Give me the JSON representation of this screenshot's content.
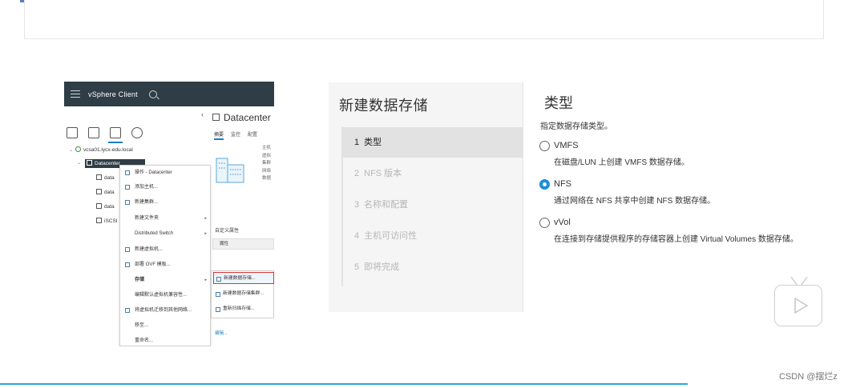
{
  "vsphere": {
    "app_title": "vSphere Client",
    "vcenter_host": "vcsa01.lycx-edu.local",
    "datacenter": "Datacenter",
    "tree_items": [
      "data",
      "data",
      "data",
      "iSCSI"
    ],
    "context_menu": {
      "header": "操作 - Datacenter",
      "items": [
        {
          "label": "添加主机...",
          "icon": "add-host-icon"
        },
        {
          "label": "新建集群...",
          "icon": "cluster-icon"
        },
        {
          "label": "新建文件夹",
          "submenu": true
        },
        {
          "label": "Distributed Switch",
          "submenu": true
        },
        {
          "label": "新建虚拟机...",
          "icon": "vm-icon"
        },
        {
          "label": "部署 OVF 模板...",
          "icon": "ovf-icon"
        },
        {
          "label": "存储",
          "submenu": true
        },
        {
          "label": "编辑默认虚拟机兼容性..."
        },
        {
          "label": "将虚拟机迁移到其他网络...",
          "icon": "migrate-icon"
        },
        {
          "label": "移至..."
        },
        {
          "label": "重命名..."
        }
      ]
    },
    "storage_submenu": [
      "新建数据存储...",
      "新建数据存储集群...",
      "重新扫描存储..."
    ],
    "right_pane": {
      "title": "Datacenter",
      "tabs": [
        "摘要",
        "监控",
        "配置"
      ],
      "info_lines": [
        "主机",
        "虚拟",
        "集群",
        "网络",
        "数据"
      ],
      "custom_attrs_title": "自定义属性",
      "attr_header": "属性",
      "edit_link": "编辑..."
    }
  },
  "wizard": {
    "title": "新建数据存储",
    "steps": [
      {
        "num": "1",
        "label": "类型",
        "active": true
      },
      {
        "num": "2",
        "label": "NFS 版本",
        "active": false
      },
      {
        "num": "3",
        "label": "名称和配置",
        "active": false
      },
      {
        "num": "4",
        "label": "主机可访问性",
        "active": false
      },
      {
        "num": "5",
        "label": "即将完成",
        "active": false
      }
    ],
    "section_title": "类型",
    "section_desc": "指定数据存储类型。",
    "options": [
      {
        "name": "VMFS",
        "desc": "在磁盘/LUN 上创建 VMFS 数据存储。",
        "selected": false
      },
      {
        "name": "NFS",
        "desc": "通过网络在 NFS 共享中创建 NFS 数据存储。",
        "selected": true
      },
      {
        "name": "vVol",
        "desc": "在连接到存储提供程序的存储容器上创建 Virtual Volumes 数据存储。",
        "selected": false
      }
    ]
  },
  "watermark": "CSDN @摆烂z",
  "colors": {
    "accent": "#1b8fd6",
    "header_bg": "#2f3d46",
    "highlight_border": "#dd3333",
    "bottom_line": "#2aa6e0"
  }
}
